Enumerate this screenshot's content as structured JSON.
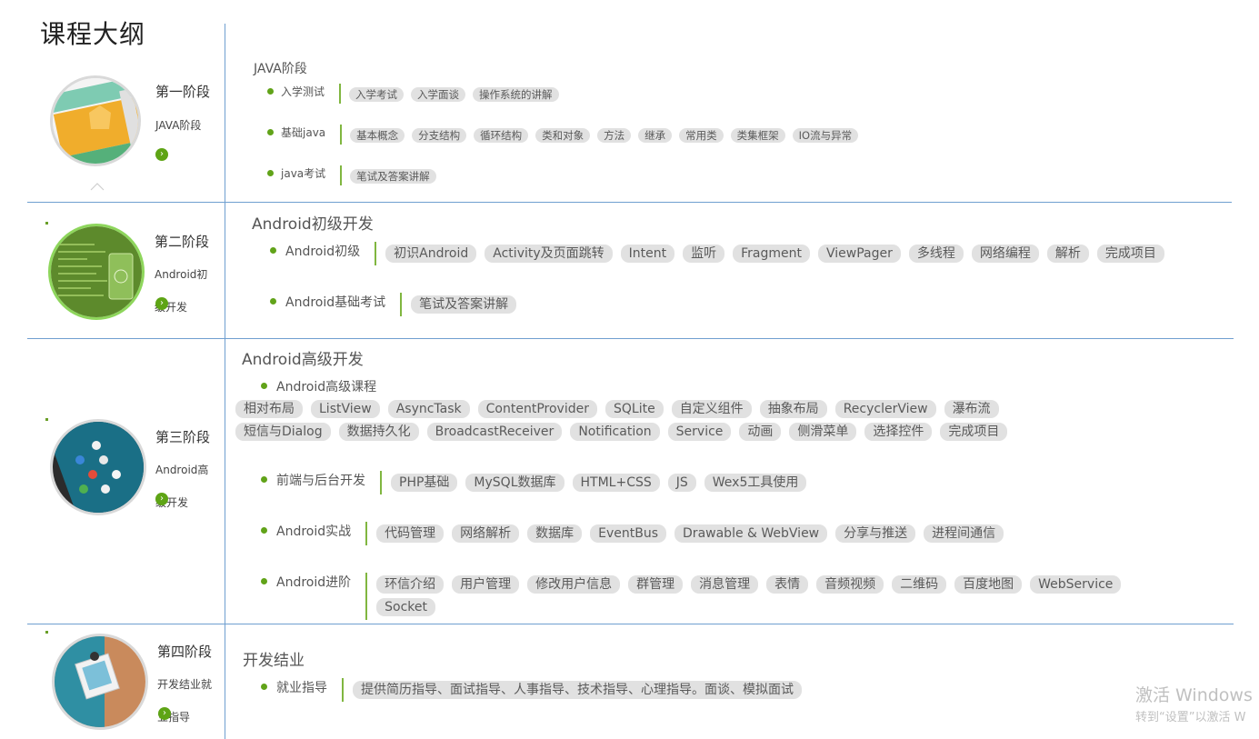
{
  "page_title": "课程大纲",
  "stages": [
    {
      "name": "第一阶段",
      "sub": "JAVA阶段"
    },
    {
      "name": "第二阶段",
      "sub": "Android初级开发"
    },
    {
      "name": "第三阶段",
      "sub": "Android高级开发"
    },
    {
      "name": "第四阶段",
      "sub": "开发结业就业指导"
    }
  ],
  "sections": [
    {
      "title": "JAVA阶段",
      "rows": [
        {
          "label": "入学测试",
          "tags": [
            "入学考试",
            "入学面谈",
            "操作系统的讲解"
          ]
        },
        {
          "label": "基础java",
          "tags": [
            "基本概念",
            "分支结构",
            "循环结构",
            "类和对象",
            "方法",
            "继承",
            "常用类",
            "类集框架",
            "IO流与异常"
          ]
        },
        {
          "label": "java考试",
          "tags": [
            "笔试及答案讲解"
          ]
        }
      ]
    },
    {
      "title": "Android初级开发",
      "rows": [
        {
          "label": "Android初级",
          "tags": [
            "初识Android",
            "Activity及页面跳转",
            "Intent",
            "监听",
            "Fragment",
            "ViewPager",
            "多线程",
            "网络编程",
            "解析",
            "完成项目"
          ]
        },
        {
          "label": "Android基础考试",
          "tags": [
            "笔试及答案讲解"
          ]
        }
      ]
    },
    {
      "title": "Android高级开发",
      "course_label": "Android高级课程",
      "course_tags": [
        "相对布局",
        "ListView",
        "AsyncTask",
        "ContentProvider",
        "SQLite",
        "自定义组件",
        "抽象布局",
        "RecyclerView",
        "瀑布流",
        "短信与Dialog",
        "数据持久化",
        "BroadcastReceiver",
        "Notification",
        "Service",
        "动画",
        "侧滑菜单",
        "选择控件",
        "完成项目"
      ],
      "rows": [
        {
          "label": "前端与后台开发",
          "tags": [
            "PHP基础",
            "MySQL数据库",
            "HTML+CSS",
            "JS",
            "Wex5工具使用"
          ]
        },
        {
          "label": "Android实战",
          "tags": [
            "代码管理",
            "网络解析",
            "数据库",
            "EventBus",
            "Drawable & WebView",
            "分享与推送",
            "进程间通信"
          ]
        },
        {
          "label": "Android进阶",
          "tags": [
            "环信介绍",
            "用户管理",
            "修改用户信息",
            "群管理",
            "消息管理",
            "表情",
            "音频视频",
            "二维码",
            "百度地图",
            "WebService",
            "Socket"
          ]
        }
      ]
    },
    {
      "title": "开发结业",
      "rows": [
        {
          "label": "就业指导",
          "tags": [
            "提供简历指导、面试指导、人事指导、技术指导、心理指导。面谈、模拟面试"
          ]
        }
      ]
    }
  ],
  "watermark": {
    "line1": "激活 Windows",
    "line2": "转到“设置”以激活 W"
  },
  "colors": {
    "divider": "#6f9fd0",
    "bullet": "#61a319",
    "tag_bg": "#e1e1e1",
    "active_ring": "#8ed65c"
  }
}
